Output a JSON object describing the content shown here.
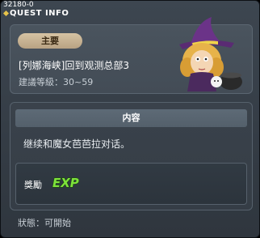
{
  "window": {
    "id_text": "32180-0",
    "title": "QUEST INFO"
  },
  "quest": {
    "type_badge": "主要",
    "name": "[列娜海峡]回到观测总部3",
    "level_label": "建議等級",
    "level_range": "30~59"
  },
  "content": {
    "header": "内容",
    "description": "继续和魔女芭芭拉对话。"
  },
  "reward": {
    "label": "獎勵",
    "exp_icon_text": "EXP"
  },
  "status": {
    "label": "狀態",
    "value": "可開始"
  },
  "colors": {
    "accent_gold": "#e7c34a",
    "exp_green": "#7ee23b",
    "badge_tan": "#c9b593"
  }
}
